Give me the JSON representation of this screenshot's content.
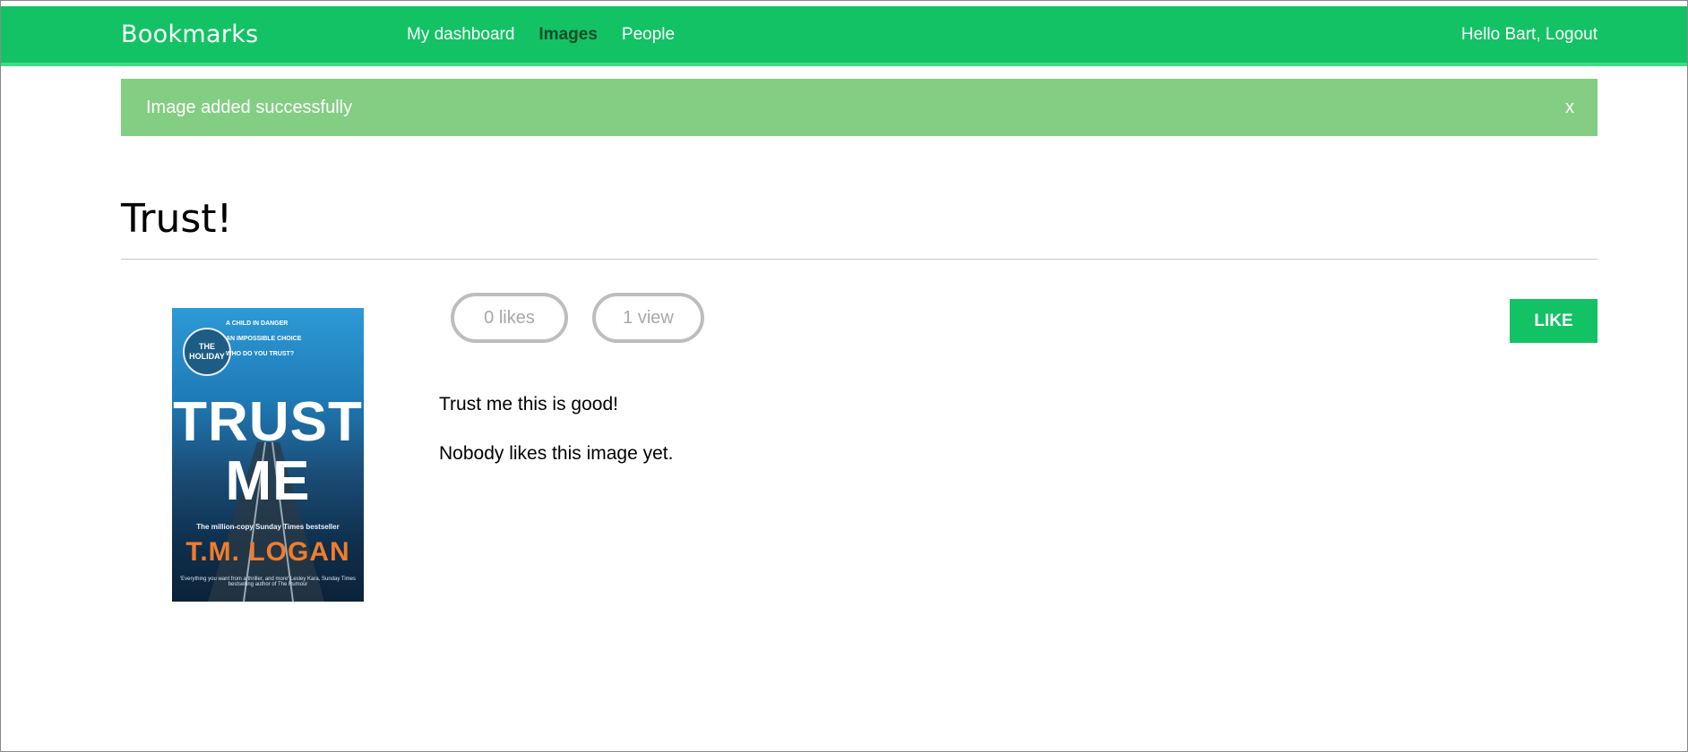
{
  "header": {
    "brand": "Bookmarks",
    "nav": [
      {
        "label": "My dashboard",
        "active": false
      },
      {
        "label": "Images",
        "active": true
      },
      {
        "label": "People",
        "active": false
      }
    ],
    "greeting": "Hello Bart,",
    "logout_label": "Logout"
  },
  "alert": {
    "message": "Image added successfully",
    "close_label": "x"
  },
  "image": {
    "title": "Trust!",
    "likes_label": "0 likes",
    "views_label": "1 view",
    "like_button_label": "LIKE",
    "description": "Trust me this is good!",
    "likers_text": "Nobody likes this image yet.",
    "cover": {
      "badge": "THE HOLIDAY",
      "taglines": [
        "A CHILD IN DANGER",
        "AN IMPOSSIBLE CHOICE",
        "WHO DO YOU TRUST?"
      ],
      "title_line1": "TRUST",
      "title_line2": "ME",
      "quote": "The million-copy Sunday Times bestseller",
      "author": "T.M. LOGAN",
      "blurb": "'Everything you want from a thriller, and more' Lesley Kara, Sunday Times bestselling author of The Rumour"
    }
  },
  "colors": {
    "brand_green": "#13c264",
    "alert_green": "#83ce83",
    "pill_border": "#bdbdbd"
  }
}
